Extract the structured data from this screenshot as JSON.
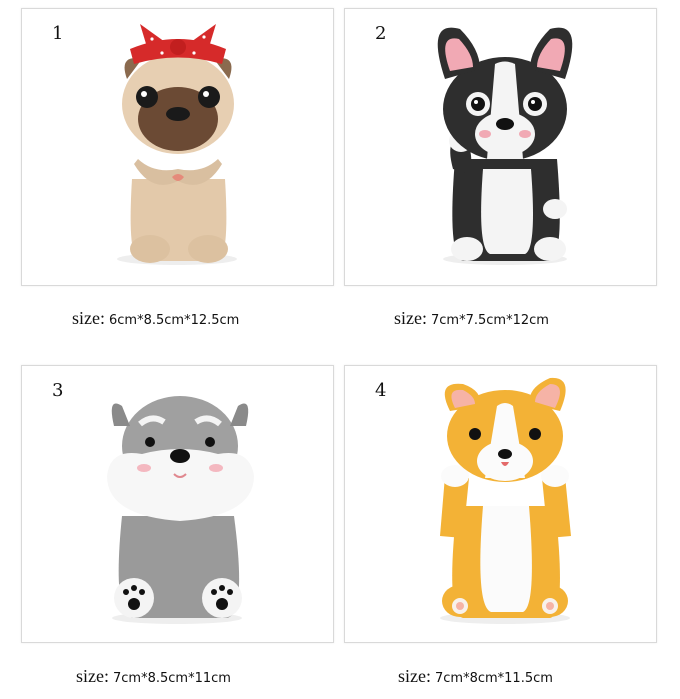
{
  "products": [
    {
      "number": "1",
      "size_label": "size:",
      "size_value": "6cm*8.5cm*12.5cm",
      "colors": {
        "body": "#e7cfb2",
        "face": "#6b4a34",
        "accent": "#d62a2a"
      }
    },
    {
      "number": "2",
      "size_label": "size:",
      "size_value": "7cm*7.5cm*12cm",
      "colors": {
        "body": "#2e2e2e",
        "face": "#ffffff",
        "accent": "#f1a9b4"
      }
    },
    {
      "number": "3",
      "size_label": "size:",
      "size_value": "7cm*8.5cm*11cm",
      "colors": {
        "body": "#9a9a9a",
        "face": "#ffffff",
        "accent": "#f4b8c0"
      }
    },
    {
      "number": "4",
      "size_label": "size:",
      "size_value": "7cm*8cm*11.5cm",
      "colors": {
        "body": "#f3b236",
        "face": "#ffffff",
        "accent": "#f6b3a6"
      }
    }
  ]
}
